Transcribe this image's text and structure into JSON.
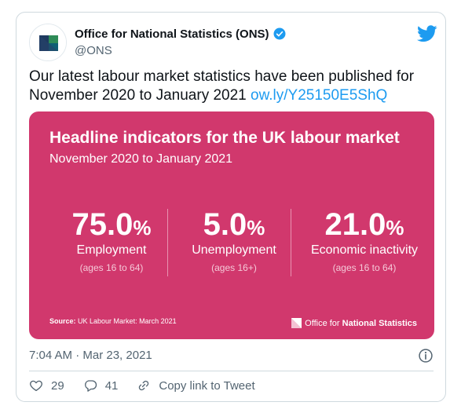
{
  "account": {
    "display_name": "Office for National Statistics (ONS)",
    "handle": "@ONS",
    "avatar_icon": "ons-logo-icon",
    "verified_icon": "verified-badge-icon",
    "platform_icon": "twitter-bird-icon"
  },
  "tweet": {
    "text": "Our latest labour market statistics have been published for November 2020 to January 2021",
    "link": "ow.ly/Y25150E5ShQ",
    "timestamp": "7:04 AM · Mar 23, 2021"
  },
  "media": {
    "background_color": "#d1386d",
    "title": "Headline indicators for the UK labour market",
    "subtitle": "November 2020 to January 2021",
    "stats": [
      {
        "value": "75.0",
        "unit": "%",
        "label": "Employment",
        "note": "(ages 16 to 64)"
      },
      {
        "value": "5.0",
        "unit": "%",
        "label": "Unemployment",
        "note": "(ages 16+)"
      },
      {
        "value": "21.0",
        "unit": "%",
        "label": "Economic inactivity",
        "note": "(ages 16 to 64)"
      }
    ],
    "source_label": "Source:",
    "source_text": "UK Labour Market: March 2021",
    "logo_text_normal": "Office for ",
    "logo_text_bold": "National Statistics"
  },
  "actions": {
    "like_count": "29",
    "reply_count": "41",
    "copy_link_label": "Copy link to Tweet"
  },
  "colors": {
    "link": "#1d9bf0",
    "verified": "#1d9bf0",
    "like": "#536471"
  }
}
